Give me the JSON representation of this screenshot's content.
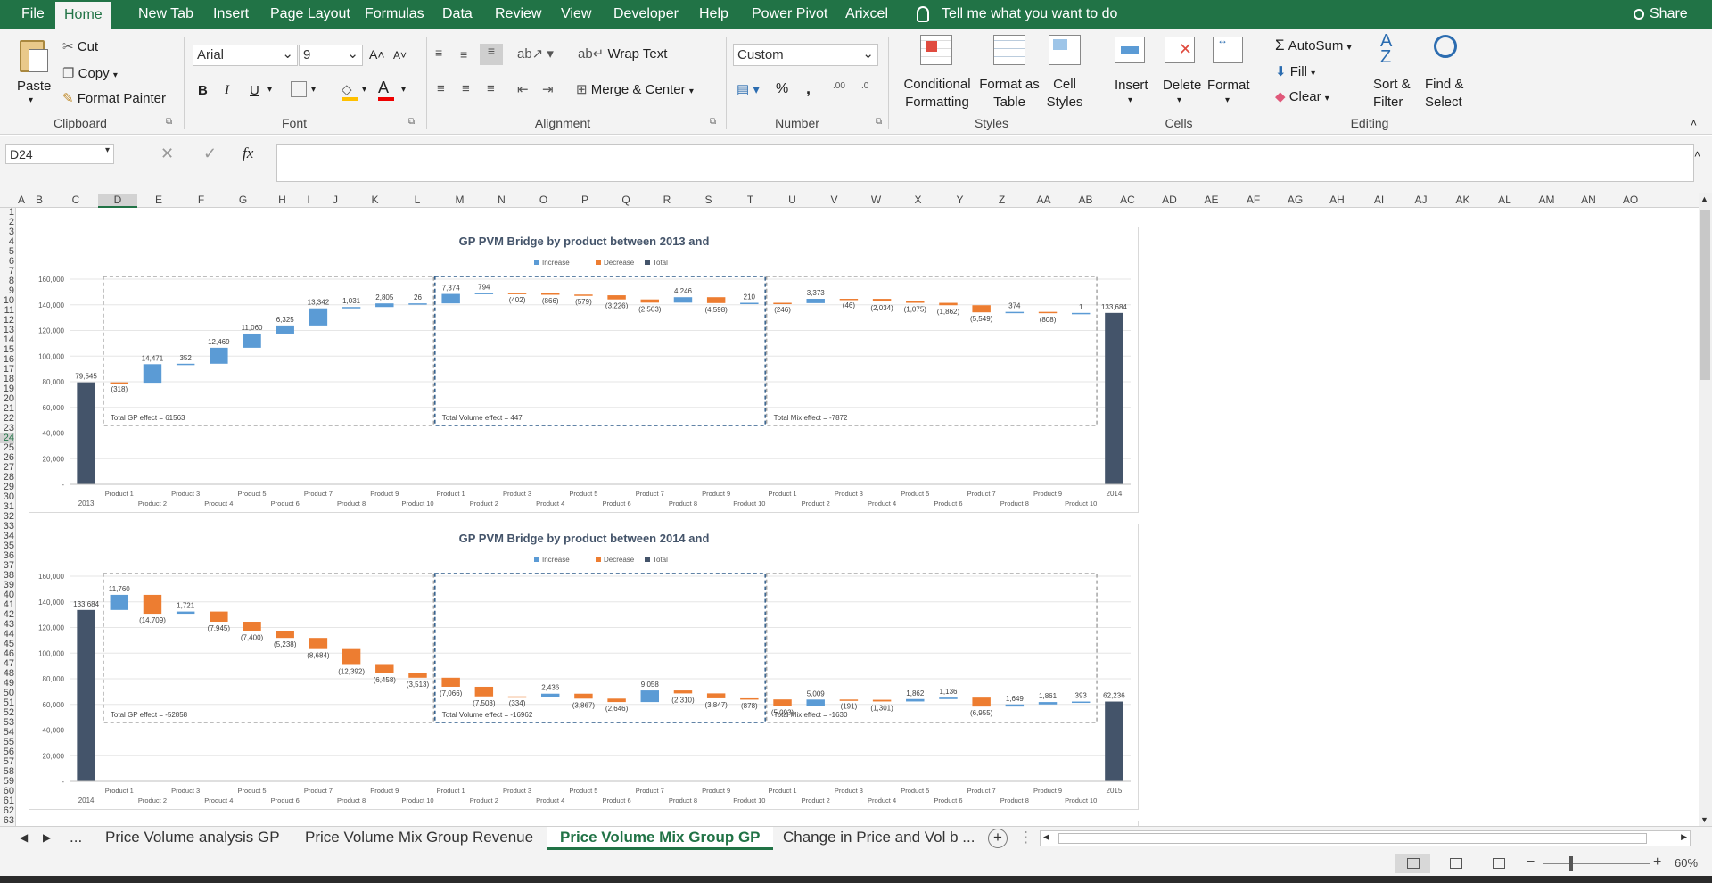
{
  "menu": {
    "file": "File",
    "tabs": [
      "Home",
      "New Tab",
      "Insert",
      "Page Layout",
      "Formulas",
      "Data",
      "Review",
      "View",
      "Developer",
      "Help",
      "Power Pivot",
      "Arixcel"
    ],
    "tell_me": "Tell me what you want to do",
    "share": "Share"
  },
  "ribbon": {
    "clipboard": {
      "paste": "Paste",
      "cut": "Cut",
      "copy": "Copy",
      "format_painter": "Format Painter",
      "label": "Clipboard"
    },
    "font": {
      "name": "Arial",
      "size": "9",
      "bold": "B",
      "italic": "I",
      "underline": "U",
      "label": "Font"
    },
    "alignment": {
      "wrap": "Wrap Text",
      "merge": "Merge & Center",
      "label": "Alignment"
    },
    "number": {
      "format": "Custom",
      "percent": "%",
      "comma": ",",
      "inc": ".00",
      "dec": ".0",
      "label": "Number"
    },
    "styles": {
      "conditional": "Conditional\nFormatting",
      "format_table": "Format as\nTable",
      "cell_styles": "Cell\nStyles",
      "label": "Styles"
    },
    "cells": {
      "insert": "Insert",
      "delete": "Delete",
      "format": "Format",
      "label": "Cells"
    },
    "editing": {
      "autosum": "AutoSum",
      "fill": "Fill",
      "clear": "Clear",
      "sort": "Sort &\nFilter",
      "find": "Find &\nSelect",
      "label": "Editing"
    }
  },
  "formula_bar": {
    "name_box": "D24",
    "fx": "fx",
    "value": ""
  },
  "columns": [
    "A",
    "B",
    "C",
    "D",
    "E",
    "F",
    "G",
    "H",
    "I",
    "J",
    "K",
    "L",
    "M",
    "N",
    "O",
    "P",
    "Q",
    "R",
    "S",
    "T",
    "U",
    "V",
    "W",
    "X",
    "Y",
    "Z",
    "AA",
    "AB",
    "AC",
    "AD",
    "AE",
    "AF",
    "AG",
    "AH",
    "AI",
    "AJ",
    "AK",
    "AL",
    "AM",
    "AN",
    "AO"
  ],
  "rows": [
    "1",
    "2",
    "3",
    "4",
    "5",
    "6",
    "7",
    "8",
    "9",
    "10",
    "11",
    "12",
    "13",
    "14",
    "15",
    "16",
    "17",
    "18",
    "19",
    "20",
    "21",
    "22",
    "23",
    "24",
    "25",
    "26",
    "27",
    "28",
    "29",
    "30",
    "31",
    "32",
    "33",
    "34",
    "35",
    "36",
    "37",
    "38",
    "39",
    "40",
    "41",
    "42",
    "43",
    "44",
    "45",
    "46",
    "47",
    "48",
    "49",
    "50",
    "51",
    "52",
    "53",
    "54",
    "55",
    "56",
    "57",
    "58",
    "59",
    "60",
    "61",
    "62",
    "63"
  ],
  "chart_data": [
    {
      "type": "bar",
      "title": "GP PVM Bridge by product between 2013 and",
      "legend": [
        "Increase",
        "Decrease",
        "Total"
      ],
      "colors": {
        "Increase": "#5b9bd5",
        "Decrease": "#ed7d31",
        "Total": "#44546a"
      },
      "ylim": [
        0,
        160000
      ],
      "yticks": [
        "-",
        "20,000",
        "40,000",
        "60,000",
        "80,000",
        "100,000",
        "120,000",
        "140,000",
        "160,000"
      ],
      "start": {
        "label": "2013",
        "value": 79545,
        "text": "79,545"
      },
      "end": {
        "label": "2014",
        "value": 133684,
        "text": "133,684"
      },
      "groups": [
        {
          "note": "Total GP effect = 61563",
          "deltas": [
            -318,
            14471,
            352,
            12469,
            11060,
            6325,
            13342,
            1031,
            2805,
            26
          ],
          "texts": [
            "(318)",
            "14,471",
            "352",
            "12,469",
            "11,060",
            "6,325",
            "13,342",
            "1,031",
            "2,805",
            "26"
          ]
        },
        {
          "note": "Total Volume effect = 447",
          "deltas": [
            7374,
            794,
            -402,
            -866,
            -579,
            -3226,
            -2503,
            4246,
            -4598,
            210
          ],
          "texts": [
            "7,374",
            "794",
            "(402)",
            "(866)",
            "(579)",
            "(3,226)",
            "(2,503)",
            "4,246",
            "(4,598)",
            "210"
          ]
        },
        {
          "note": "Total Mix effect = -7872",
          "deltas": [
            -246,
            3373,
            -46,
            -2034,
            -1075,
            -1862,
            -5549,
            374,
            -808,
            1
          ],
          "texts": [
            "(246)",
            "3,373",
            "(46)",
            "(2,034)",
            "(1,075)",
            "(1,862)",
            "(5,549)",
            "374",
            "(808)",
            "1"
          ]
        }
      ],
      "categories": [
        "Product 1",
        "Product 2",
        "Product 3",
        "Product 4",
        "Product 5",
        "Product 6",
        "Product 7",
        "Product 8",
        "Product 9",
        "Product 10"
      ]
    },
    {
      "type": "bar",
      "title": "GP PVM Bridge by product between 2014 and",
      "legend": [
        "Increase",
        "Decrease",
        "Total"
      ],
      "colors": {
        "Increase": "#5b9bd5",
        "Decrease": "#ed7d31",
        "Total": "#44546a"
      },
      "ylim": [
        0,
        160000
      ],
      "yticks": [
        "-",
        "20,000",
        "40,000",
        "60,000",
        "80,000",
        "100,000",
        "120,000",
        "140,000",
        "160,000"
      ],
      "start": {
        "label": "2014",
        "value": 133684,
        "text": "133,684"
      },
      "end": {
        "label": "2015",
        "value": 62236,
        "text": "62,236"
      },
      "groups": [
        {
          "note": "Total GP effect = -52858",
          "deltas": [
            11760,
            -14709,
            1721,
            -7945,
            -7400,
            -5238,
            -8684,
            -12392,
            -6458,
            -3513
          ],
          "texts": [
            "11,760",
            "(14,709)",
            "1,721",
            "(7,945)",
            "(7,400)",
            "(5,238)",
            "(8,684)",
            "(12,392)",
            "(6,458)",
            "(3,513)"
          ]
        },
        {
          "note": "Total Volume effect = -16962",
          "deltas": [
            -7066,
            -7503,
            -334,
            2436,
            -3867,
            -2646,
            9058,
            -2310,
            -3847,
            -878
          ],
          "texts": [
            "(7,066)",
            "(7,503)",
            "(334)",
            "2,436",
            "(3,867)",
            "(2,646)",
            "9,058",
            "(2,310)",
            "(3,847)",
            "(878)"
          ]
        },
        {
          "note": "Total Mix effect = -1630",
          "deltas": [
            -5093,
            5009,
            -191,
            -1301,
            1862,
            1136,
            -6955,
            1649,
            1861,
            393
          ],
          "texts": [
            "(5,093)",
            "5,009",
            "(191)",
            "(1,301)",
            "1,862",
            "1,136",
            "(6,955)",
            "1,649",
            "1,861",
            "393"
          ]
        }
      ],
      "categories": [
        "Product 1",
        "Product 2",
        "Product 3",
        "Product 4",
        "Product 5",
        "Product 6",
        "Product 7",
        "Product 8",
        "Product 9",
        "Product 10"
      ]
    }
  ],
  "sheet_tabs": [
    "Price Volume analysis GP",
    "Price Volume Mix Group Revenue",
    "Price Volume Mix Group GP",
    "Change in Price and Vol b ..."
  ],
  "active_tab": 2,
  "sheet_nav": {
    "ellipsis": "...",
    "more": "⋮"
  },
  "status": {
    "zoom": "60%"
  }
}
